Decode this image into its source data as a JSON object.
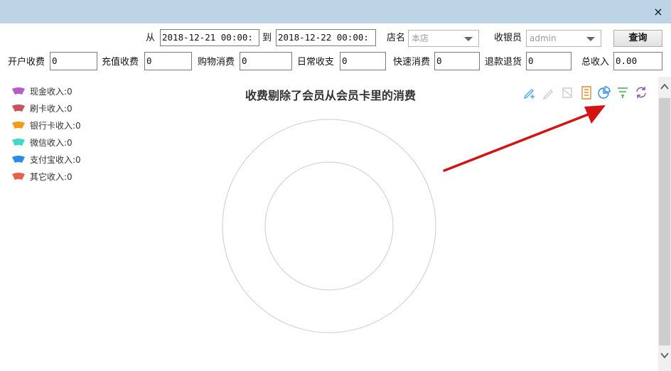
{
  "window": {
    "close_glyph": "×"
  },
  "filters": {
    "from_label": "从",
    "from_value": "2018-12-21 00:00:",
    "to_label": "到",
    "to_value": "2018-12-22 00:00:",
    "store_label": "店名",
    "store_value": "本店",
    "cashier_label": "收银员",
    "cashier_value": "admin",
    "query_label": "查询"
  },
  "summary": [
    {
      "label": "开户收费",
      "value": "0"
    },
    {
      "label": "充值收费",
      "value": "0"
    },
    {
      "label": "购物消费",
      "value": "0"
    },
    {
      "label": "日常收支",
      "value": "0"
    },
    {
      "label": "快速消费",
      "value": "0"
    },
    {
      "label": "退款退货",
      "value": "0"
    },
    {
      "label": "总收入",
      "value": "0.00"
    }
  ],
  "chart": {
    "title": "收费剔除了会员从会员卡里的消费",
    "legend": [
      {
        "label": "现金收入:0",
        "color": "#b55cc8"
      },
      {
        "label": "刷卡收入:0",
        "color": "#c4555a"
      },
      {
        "label": "银行卡收入:0",
        "color": "#f29b19"
      },
      {
        "label": "微信收入:0",
        "color": "#40d8c8"
      },
      {
        "label": "支付宝收入:0",
        "color": "#2e8ae8"
      },
      {
        "label": "其它收入:0",
        "color": "#e8604a"
      }
    ],
    "toolbox": [
      {
        "name": "edit-data-icon",
        "color": "#4ea8e0"
      },
      {
        "name": "edit-disabled-icon",
        "color": "#cccccc"
      },
      {
        "name": "clear-icon",
        "color": "#cccccc"
      },
      {
        "name": "data-view-icon",
        "color": "#e08a2e"
      },
      {
        "name": "pie-chart-icon",
        "color": "#2e8ae8"
      },
      {
        "name": "filter-icon",
        "color": "#3cb34a"
      },
      {
        "name": "refresh-icon",
        "color": "#8e44ad"
      }
    ]
  },
  "chart_data": {
    "type": "pie",
    "title": "收费剔除了会员从会员卡里的消费",
    "categories": [
      "现金收入",
      "刷卡收入",
      "银行卡收入",
      "微信收入",
      "支付宝收入",
      "其它收入"
    ],
    "values": [
      0,
      0,
      0,
      0,
      0,
      0
    ],
    "legend_position": "top-left"
  },
  "annotation": {
    "arrow_color": "#d21414"
  }
}
